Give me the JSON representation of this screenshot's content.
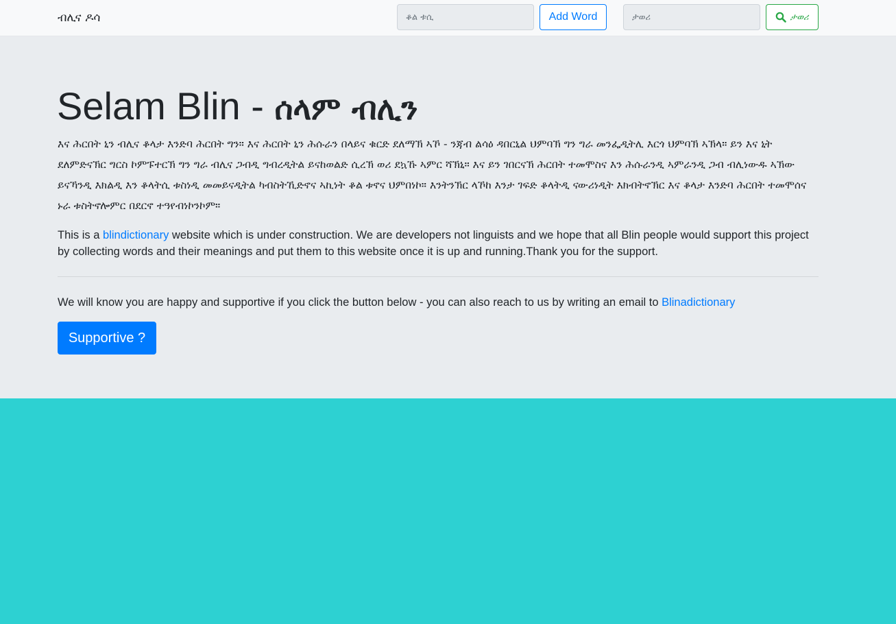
{
  "navbar": {
    "brand": "ብሊና ዶሳ",
    "word_input_placeholder": "ቆል ቱሲ",
    "add_word_label": "Add Word",
    "search_input_placeholder": "ታወሪ",
    "search_button_label": "ታወሪ"
  },
  "jumbotron": {
    "title_latin": "Selam Blin - ",
    "title_geez": "ሰላም ብሊን",
    "geez_paragraph": "እና ሕርበት ኒን ብሊና ቆላታ እንድባ ሕርበት ግን። እና ሕርበት ኒን ሕሱራን በላይና ቁርድ ደለማኽ ኣኾ - ንጃብ ልሳዕ ዳበርኒል ህምባኽ ግን ግራ መንፌዲትሊ እርጎ ህምባኽ ኣኽላ። ይን እና ኒት ደለምድናኽር ግርስ ኮምፑተርኽ ግን ግራ ብሊና ጋብዲ ግብረዲትል ይናከወልድ ሲረኽ ወሪ ደኳኹ ኣምር ሻኽኒ። እና ይን ገበርናኽ ሕርበት ተመሞስና እን ሕሱራንዲ ኣምራንዲ ጋብ ብሊነውዱ ኣኽው ይናኻንዲ እክልዲ እን ቆላትሲ ቱስነዲ መመይናዲትል ካብስትኺድኖና ኣኪነት ቆል ቱኖና ህምበነኮ። እንትንኽር ላኾከ እንታ ገፍድ ቆላትዲ ናውሪነዲት እክብትኖኽር እና ቆላታ እንድባ ሕርበት ተመሞሰና ኑራ ቱስትኖሎምር በደርኖ ተዓየብነኮንኮም።",
    "lead_prefix": "This is a ",
    "lead_link": "blindictionary",
    "lead_suffix": " website which is under construction. We are developers not linguists and we hope that all Blin people would support this project by collecting words and their meanings and put them to this website once it is up and running.Thank you for the support.",
    "email_prefix": "We will know you are happy and supportive if you click the button below - you can also reach to us by writing an email to ",
    "email_link": "Blinadictionary",
    "supportive_button": "Supportive ?"
  },
  "colors": {
    "navbar_bg": "#f8f9fa",
    "jumbotron_bg": "#e9ecef",
    "page_bg": "#2dd1d2",
    "primary": "#007bff",
    "success": "#28a745"
  },
  "icons": {
    "search_button_icon": "search-icon"
  }
}
